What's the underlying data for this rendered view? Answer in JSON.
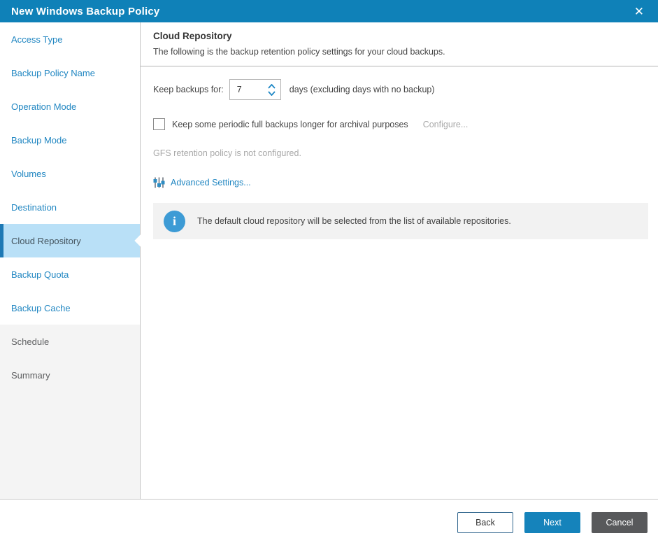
{
  "window": {
    "title": "New Windows Backup Policy",
    "close_glyph": "✕"
  },
  "sidebar": {
    "items": [
      {
        "label": "Access Type",
        "state": "visited"
      },
      {
        "label": "Backup Policy Name",
        "state": "visited"
      },
      {
        "label": "Operation Mode",
        "state": "visited"
      },
      {
        "label": "Backup Mode",
        "state": "visited"
      },
      {
        "label": "Volumes",
        "state": "visited"
      },
      {
        "label": "Destination",
        "state": "visited"
      },
      {
        "label": "Cloud Repository",
        "state": "selected"
      },
      {
        "label": "Backup Quota",
        "state": "visited"
      },
      {
        "label": "Backup Cache",
        "state": "visited"
      },
      {
        "label": "Schedule",
        "state": "upcoming"
      },
      {
        "label": "Summary",
        "state": "upcoming"
      }
    ]
  },
  "content": {
    "title": "Cloud Repository",
    "subtitle": "The following is the backup retention policy settings for your cloud backups.",
    "retention": {
      "label": "Keep backups for:",
      "value": "7",
      "suffix": "days (excluding days with no backup)"
    },
    "gfs": {
      "checkbox_label": "Keep some periodic full backups longer for archival purposes",
      "checked": false,
      "configure_label": "Configure...",
      "status": "GFS retention policy is not configured."
    },
    "advanced_settings_label": "Advanced Settings...",
    "info_banner": "The default cloud repository will be selected from the list of available repositories."
  },
  "footer": {
    "back_label": "Back",
    "next_label": "Next",
    "cancel_label": "Cancel"
  },
  "colors": {
    "titlebar_blue": "#0f81b8",
    "link_blue": "#2287c2",
    "selected_item_bg": "#b9e0f7",
    "selected_item_border": "#1d79b5",
    "next_button_blue": "#1583bb",
    "cancel_button_gray": "#58595b",
    "info_icon_blue": "#3d9bd5",
    "banner_bg": "#f2f2f2",
    "disabled_text": "#a8a8a8"
  }
}
